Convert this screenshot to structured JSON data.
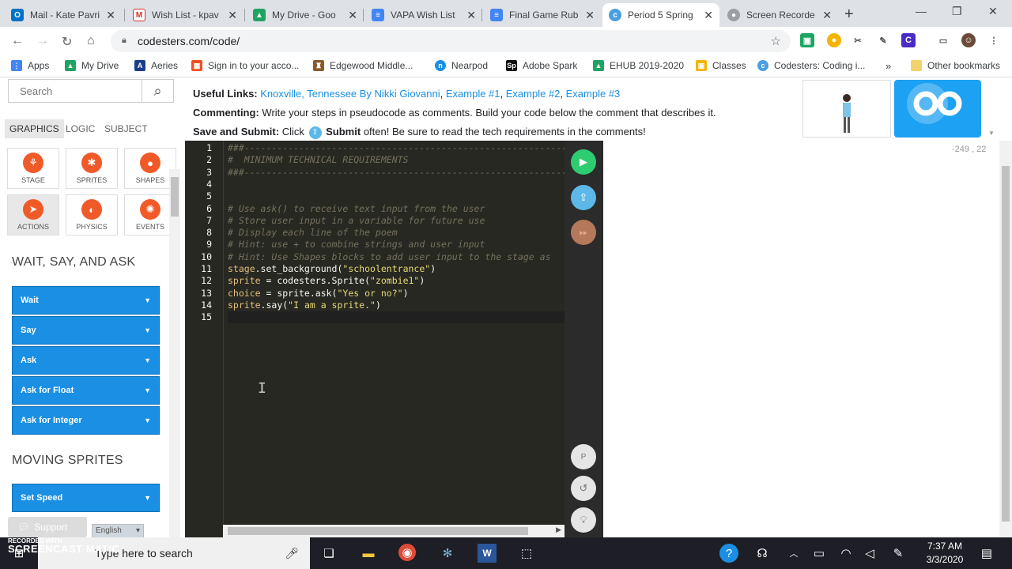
{
  "browser": {
    "tabs": [
      {
        "title": "Mail - Kate Pavri",
        "icon": "outlook-icon",
        "color": "#0072c6"
      },
      {
        "title": "Wish List - kpav",
        "icon": "gmail-icon",
        "color": "#d93025"
      },
      {
        "title": "My Drive - Goo",
        "icon": "drive-icon",
        "color": "#1fa463"
      },
      {
        "title": "VAPA Wish List",
        "icon": "docs-icon",
        "color": "#4285f4"
      },
      {
        "title": "Final Game Rub",
        "icon": "docs-icon",
        "color": "#4285f4"
      },
      {
        "title": "Period 5 Spring",
        "icon": "codesters-icon",
        "color": "#4a9fe0",
        "active": true
      },
      {
        "title": "Screen Recorde",
        "icon": "recorder-icon",
        "color": "#9aa0a6"
      }
    ],
    "url": "codesters.com/code/",
    "bookmarks": [
      {
        "label": "Apps",
        "color": "#4285f4"
      },
      {
        "label": "My Drive",
        "color": "#1fa463"
      },
      {
        "label": "Aeries",
        "color": "#1a3e8c"
      },
      {
        "label": "Sign in to your acco...",
        "color": "#f25022"
      },
      {
        "label": "Edgewood Middle...",
        "color": "#8b5a2b"
      },
      {
        "label": "Nearpod",
        "color": "#1a8fe3"
      },
      {
        "label": "Adobe Spark",
        "color": "#111111"
      },
      {
        "label": "EHUB 2019-2020",
        "color": "#1fa463"
      },
      {
        "label": "Classes",
        "color": "#f4b400"
      },
      {
        "label": "Codesters: Coding i...",
        "color": "#4a9fe0"
      }
    ],
    "more_bookmarks": "»",
    "other_bookmarks": "Other bookmarks"
  },
  "sidebar": {
    "search_placeholder": "Search",
    "tabs": [
      "GRAPHICS",
      "LOGIC",
      "SUBJECT"
    ],
    "categories": [
      {
        "label": "STAGE",
        "icon": "stage-icon"
      },
      {
        "label": "SPRITES",
        "icon": "sprites-icon"
      },
      {
        "label": "SHAPES",
        "icon": "shapes-icon"
      },
      {
        "label": "ACTIONS",
        "icon": "actions-icon"
      },
      {
        "label": "PHYSICS",
        "icon": "physics-icon"
      },
      {
        "label": "EVENTS",
        "icon": "events-icon"
      }
    ],
    "section1": "WAIT, SAY, AND ASK",
    "section1_blocks": [
      "Wait",
      "Say",
      "Ask",
      "Ask for Float",
      "Ask for Integer"
    ],
    "section2": "MOVING SPRITES",
    "section2_blocks": [
      "Set Speed"
    ],
    "support": "Support",
    "language": "English"
  },
  "info": {
    "useful_links_label": "Useful Links:",
    "links": [
      "Knoxville, Tennessee By Nikki Giovanni",
      "Example #1",
      "Example #2",
      "Example #3"
    ],
    "commenting_label": "Commenting:",
    "commenting_text": "Write your steps in pseudocode as comments. Build your code below the comment that describes it.",
    "save_label": "Save and Submit:",
    "save_text_pre": "Click",
    "submit_word": "Submit",
    "save_text_post": "often! Be sure to read the tech requirements in the comments!"
  },
  "editor": {
    "lines": [
      {
        "n": "1",
        "text": "###--------------------------------------------------------------",
        "type": "comment"
      },
      {
        "n": "2",
        "text": "#  MINIMUM TECHNICAL REQUIREMENTS",
        "type": "comment"
      },
      {
        "n": "3",
        "text": "###--------------------------------------------------------------",
        "type": "comment"
      },
      {
        "n": "4",
        "text": "",
        "type": "code"
      },
      {
        "n": "5",
        "text": "",
        "type": "code"
      },
      {
        "n": "6",
        "text": "# Use ask() to receive text input from the user",
        "type": "comment"
      },
      {
        "n": "7",
        "text": "# Store user input in a variable for future use",
        "type": "comment"
      },
      {
        "n": "8",
        "text": "# Display each line of the poem",
        "type": "comment"
      },
      {
        "n": "9",
        "text": "# Hint: use + to combine strings and user input",
        "type": "comment"
      },
      {
        "n": "10",
        "text": "# Hint: Use Shapes blocks to add user input to the stage as",
        "type": "comment"
      },
      {
        "n": "11",
        "text": "stage.set_background(\"schoolentrance\")",
        "type": "code"
      },
      {
        "n": "12",
        "text": "sprite = codesters.Sprite(\"zombie1\")",
        "type": "code"
      },
      {
        "n": "13",
        "text": "choice = sprite.ask(\"Yes or no?\")",
        "type": "code"
      },
      {
        "n": "14",
        "text": "sprite.say(\"I am a sprite.\")",
        "type": "code"
      },
      {
        "n": "15",
        "text": "",
        "type": "current"
      }
    ],
    "buttons": {
      "pause_label": "P"
    }
  },
  "stage": {
    "coords": "-249 , 22"
  },
  "taskbar": {
    "search_placeholder": "Type here to search",
    "time": "7:37 AM",
    "date": "3/3/2020",
    "watermark_top": "RECORDED WITH",
    "watermark_brand": "SCREENCAST",
    "watermark_suffix": "MATIC"
  },
  "colors": {
    "block_blue": "#1a8fe3",
    "editor_bg": "#272822",
    "run_green": "#2ecc71",
    "submit_blue": "#5bb8e8",
    "step_orange": "#b5785a"
  }
}
